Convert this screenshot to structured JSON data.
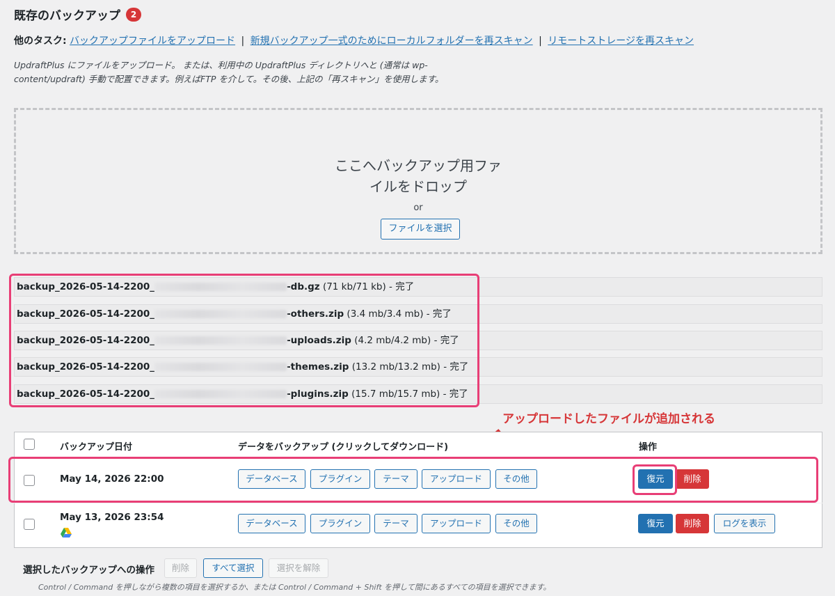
{
  "header": {
    "title": "既存のバックアップ",
    "count": "2"
  },
  "tasks": {
    "label": "他のタスク:",
    "link_upload": "バックアップファイルをアップロード",
    "link_rescan_local": "新規バックアップ一式のためにローカルフォルダーを再スキャン",
    "link_rescan_remote": "リモートストレージを再スキャン",
    "separator": "|"
  },
  "description": "UpdraftPlus にファイルをアップロード。 または、利用中の UpdraftPlus ディレクトリへと (通常は wp-content/updraft) 手動で配置できます。例えばFTP を介して。その後、上記の「再スキャン」を使用します。",
  "dropzone": {
    "text_line1": "ここへバックアップ用ファ",
    "text_line2": "イルをドロップ",
    "or": "or",
    "select_button": "ファイルを選択"
  },
  "uploaded_files": [
    {
      "prefix": "backup_2026-05-14-2200_",
      "suffix": "-db.gz",
      "meta": " (71 kb/71 kb) - 完了"
    },
    {
      "prefix": "backup_2026-05-14-2200_",
      "suffix": "-others.zip",
      "meta": " (3.4 mb/3.4 mb) - 完了"
    },
    {
      "prefix": "backup_2026-05-14-2200_",
      "suffix": "-uploads.zip",
      "meta": " (4.2 mb/4.2 mb) - 完了"
    },
    {
      "prefix": "backup_2026-05-14-2200_",
      "suffix": "-themes.zip",
      "meta": " (13.2 mb/13.2 mb) - 完了"
    },
    {
      "prefix": "backup_2026-05-14-2200_",
      "suffix": "-plugins.zip",
      "meta": " (15.7 mb/15.7 mb) - 完了"
    }
  ],
  "annotation": "アップロードしたファイルが追加される",
  "table": {
    "col_date": "バックアップ日付",
    "col_data": "データをバックアップ (クリックしてダウンロード)",
    "col_actions": "操作",
    "rows": [
      {
        "date": "May 14, 2026 22:00",
        "buttons": [
          "データベース",
          "プラグイン",
          "テーマ",
          "アップロード",
          "その他"
        ],
        "restore": "復元",
        "delete": "削除"
      },
      {
        "date": "May 13, 2026 23:54",
        "buttons": [
          "データベース",
          "プラグイン",
          "テーマ",
          "アップロード",
          "その他"
        ],
        "restore": "復元",
        "delete": "削除",
        "view_log": "ログを表示"
      }
    ]
  },
  "bulk": {
    "label": "選択したバックアップへの操作",
    "delete": "削除",
    "select_all": "すべて選択",
    "deselect": "選択を解除",
    "hint": "Control / Command を押しながら複数の項目を選択するか、または Control / Command + Shift を押して間にあるすべての項目を選択できます。"
  },
  "colors": {
    "link": "#2271b1",
    "danger": "#d63638",
    "highlight": "#e83e76"
  }
}
